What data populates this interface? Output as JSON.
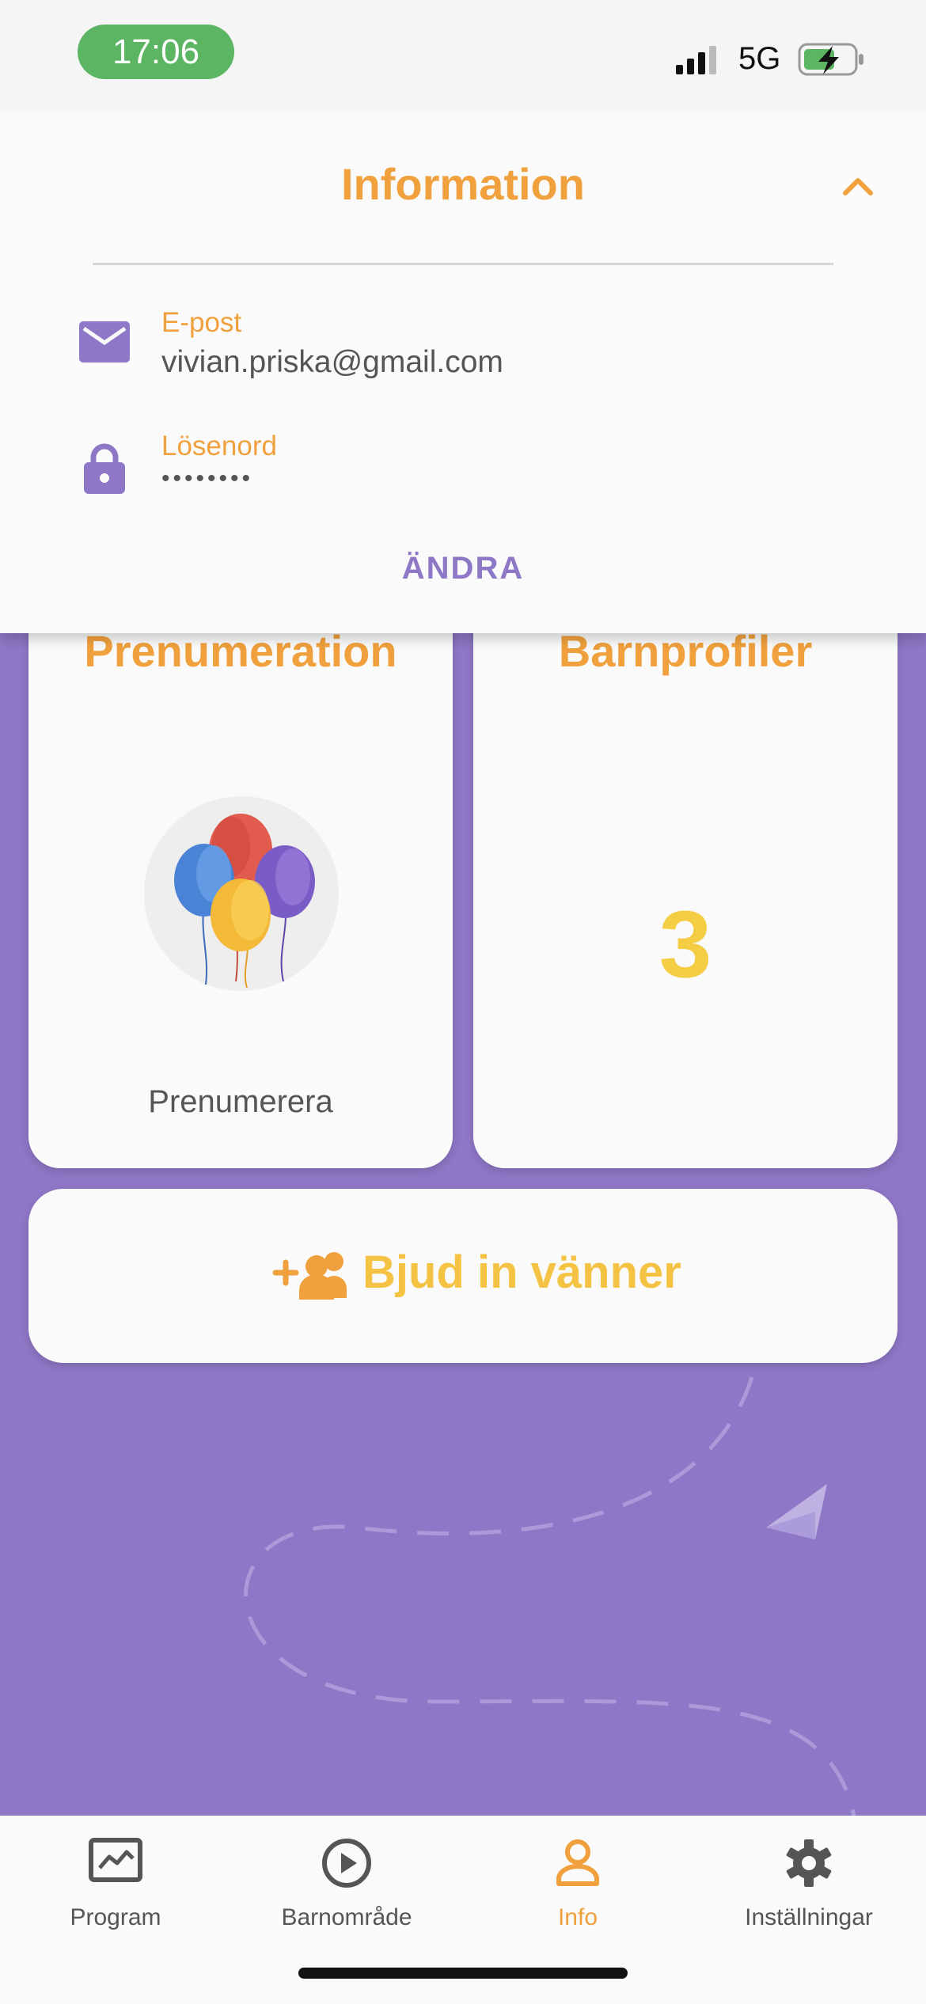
{
  "status_bar": {
    "time": "17:06",
    "network": "5G"
  },
  "info_panel": {
    "title": "Information",
    "email_label": "E-post",
    "email_value": "vivian.priska@gmail.com",
    "password_label": "Lösenord",
    "password_value": "••••••••",
    "edit_label": "ÄNDRA"
  },
  "cards": {
    "subscription_title": "Prenumeration",
    "subscription_action": "Prenumerera",
    "child_profiles_title": "Barnprofiler",
    "child_profiles_count": "3"
  },
  "invite": {
    "label": "Bjud in vänner"
  },
  "tabs": [
    {
      "label": "Program",
      "icon": "chart-icon"
    },
    {
      "label": "Barnområde",
      "icon": "play-icon"
    },
    {
      "label": "Info",
      "icon": "person-icon"
    },
    {
      "label": "Inställningar",
      "icon": "gear-icon"
    }
  ],
  "colors": {
    "accent": "#f0a03c",
    "purple": "#8e77c6",
    "yellow": "#f5c343",
    "status_green": "#5bb563"
  }
}
